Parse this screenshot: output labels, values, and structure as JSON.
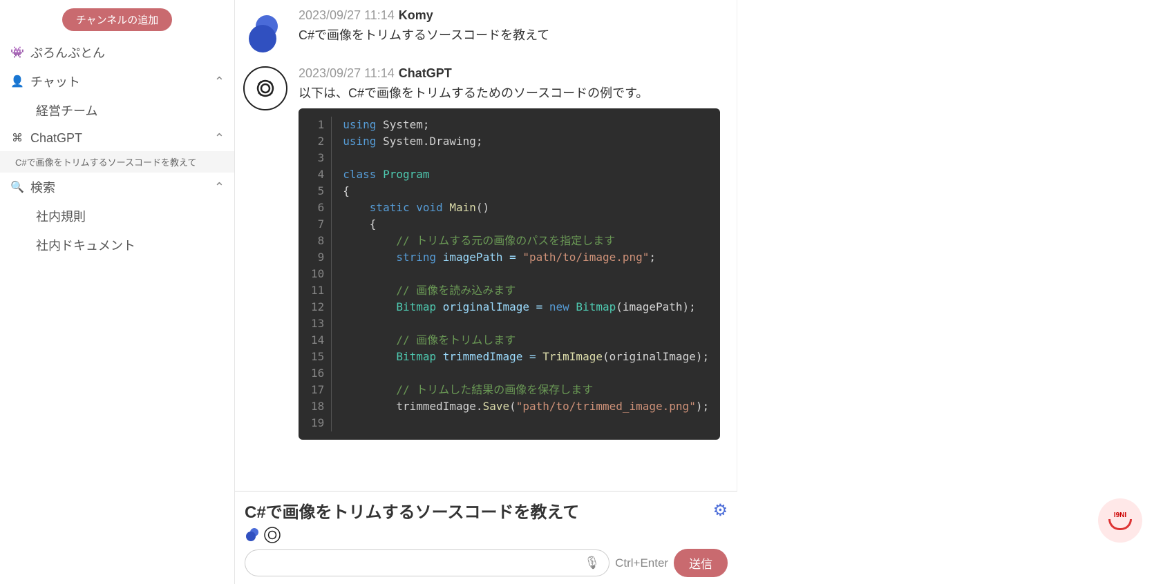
{
  "sidebar": {
    "add_channel": "チャンネルの追加",
    "items": [
      {
        "icon": "👾",
        "label": "ぷろんぷとん"
      },
      {
        "icon": "👤",
        "label": "チャット",
        "chevron": true
      },
      {
        "icon": "",
        "label": "経営チーム",
        "sub": true
      },
      {
        "icon": "⌘",
        "label": "ChatGPT",
        "chevron": true
      },
      {
        "subitem": true,
        "label": "C#で画像をトリムするソースコードを教えて"
      },
      {
        "icon": "🔍",
        "label": "検索",
        "chevron": true
      },
      {
        "icon": "",
        "label": "社内規則",
        "sub": true
      },
      {
        "icon": "",
        "label": "社内ドキュメント",
        "sub": true
      }
    ]
  },
  "messages": [
    {
      "time": "2023/09/27 11:14",
      "author": "Komy",
      "avatar": "user",
      "text": "C#で画像をトリムするソースコードを教えて"
    },
    {
      "time": "2023/09/27 11:14",
      "author": "ChatGPT",
      "avatar": "gpt",
      "text": "以下は、C#で画像をトリムするためのソースコードの例です。",
      "code": {
        "lines": [
          [
            {
              "t": "using ",
              "c": "kw"
            },
            {
              "t": "System;",
              "c": ""
            }
          ],
          [
            {
              "t": "using ",
              "c": "kw"
            },
            {
              "t": "System.Drawing;",
              "c": ""
            }
          ],
          [],
          [
            {
              "t": "class ",
              "c": "kw"
            },
            {
              "t": "Program",
              "c": "type"
            }
          ],
          [
            {
              "t": "{",
              "c": ""
            }
          ],
          [
            {
              "t": "    ",
              "c": ""
            },
            {
              "t": "static void ",
              "c": "kw"
            },
            {
              "t": "Main",
              "c": "fn"
            },
            {
              "t": "()",
              "c": ""
            }
          ],
          [
            {
              "t": "    {",
              "c": ""
            }
          ],
          [
            {
              "t": "        ",
              "c": ""
            },
            {
              "t": "// トリムする元の画像のパスを指定します",
              "c": "comment"
            }
          ],
          [
            {
              "t": "        ",
              "c": ""
            },
            {
              "t": "string ",
              "c": "kw"
            },
            {
              "t": "imagePath = ",
              "c": "var"
            },
            {
              "t": "\"path/to/image.png\"",
              "c": "str"
            },
            {
              "t": ";",
              "c": ""
            }
          ],
          [],
          [
            {
              "t": "        ",
              "c": ""
            },
            {
              "t": "// 画像を読み込みます",
              "c": "comment"
            }
          ],
          [
            {
              "t": "        ",
              "c": ""
            },
            {
              "t": "Bitmap ",
              "c": "type"
            },
            {
              "t": "originalImage = ",
              "c": "var"
            },
            {
              "t": "new ",
              "c": "kw"
            },
            {
              "t": "Bitmap",
              "c": "type"
            },
            {
              "t": "(imagePath);",
              "c": ""
            }
          ],
          [],
          [
            {
              "t": "        ",
              "c": ""
            },
            {
              "t": "// 画像をトリムします",
              "c": "comment"
            }
          ],
          [
            {
              "t": "        ",
              "c": ""
            },
            {
              "t": "Bitmap ",
              "c": "type"
            },
            {
              "t": "trimmedImage = ",
              "c": "var"
            },
            {
              "t": "TrimImage",
              "c": "fn"
            },
            {
              "t": "(originalImage);",
              "c": ""
            }
          ],
          [],
          [
            {
              "t": "        ",
              "c": ""
            },
            {
              "t": "// トリムした結果の画像を保存します",
              "c": "comment"
            }
          ],
          [
            {
              "t": "        trimmedImage.",
              "c": ""
            },
            {
              "t": "Save",
              "c": "fn"
            },
            {
              "t": "(",
              "c": ""
            },
            {
              "t": "\"path/to/trimmed_image.png\"",
              "c": "str"
            },
            {
              "t": ");",
              "c": ""
            }
          ],
          []
        ]
      }
    }
  ],
  "composer": {
    "title": "C#で画像をトリムするソースコードを教えて",
    "input_placeholder": "",
    "shortcut": "Ctrl+Enter",
    "send": "送信"
  },
  "badge_text": "I9NI"
}
